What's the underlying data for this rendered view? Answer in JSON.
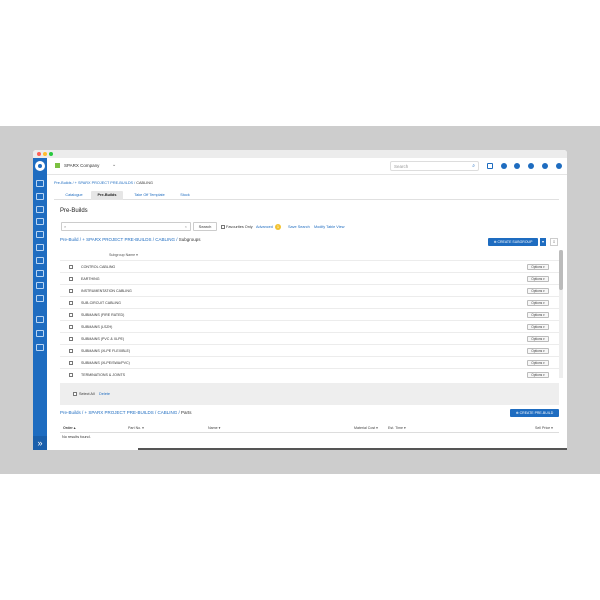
{
  "topbar": {
    "company": "SPARX Company",
    "search_placeholder": "Search"
  },
  "breadcrumb": {
    "trail": "Pre-Builds / + SPARX PROJECT PRE-BUILDS / ",
    "current": "CABLING"
  },
  "tabs": [
    "Catalogue",
    "Pre-Builds",
    "Take Off Template",
    "Stock"
  ],
  "page_title": "Pre-Builds",
  "filters": {
    "search_button": "Search",
    "favourites_label": "Favourites Only",
    "advanced": "Advanced",
    "advanced_count": "1",
    "save_search": "Save Search",
    "modify_view": "Modify Table View"
  },
  "subgroups": {
    "path": "Pre-Build / + SPARX PROJECT PRE-BUILDS / CABLING / ",
    "path_current": "Subgroups",
    "create_button": "CREATE SUBGROUP",
    "column": "Subgroup Name",
    "options_label": "Options",
    "rows": [
      "CONTROL CABLING",
      "EARTHING",
      "INSTRUMENTATION CABLING",
      "SUB-CIRCUIT CABLING",
      "SUBMAINS (FIRE RATED)",
      "SUBMAINS (LSZH)",
      "SUBMAINS (PVC & XLPE)",
      "SUBMAINS (XLPE FLEXIBLE)",
      "SUBMAINS (XLPE/SWA/PVC)",
      "TERMINATIONS & JOINTS"
    ],
    "select_all": "Select All",
    "delete": "Delete"
  },
  "parts": {
    "path": "Pre-Builds / + SPARX PROJECT PRE-BUILDS / CABLING / ",
    "path_current": "Parts",
    "create_button": "CREATE PRE-BUILD",
    "columns": [
      "Order",
      "Part No.",
      "Name",
      "Material Cost",
      "Est. Time",
      "Sell Price"
    ],
    "empty": "No results found."
  },
  "colors": {
    "accent": "#1e6cc0",
    "warning": "#f2c230"
  }
}
